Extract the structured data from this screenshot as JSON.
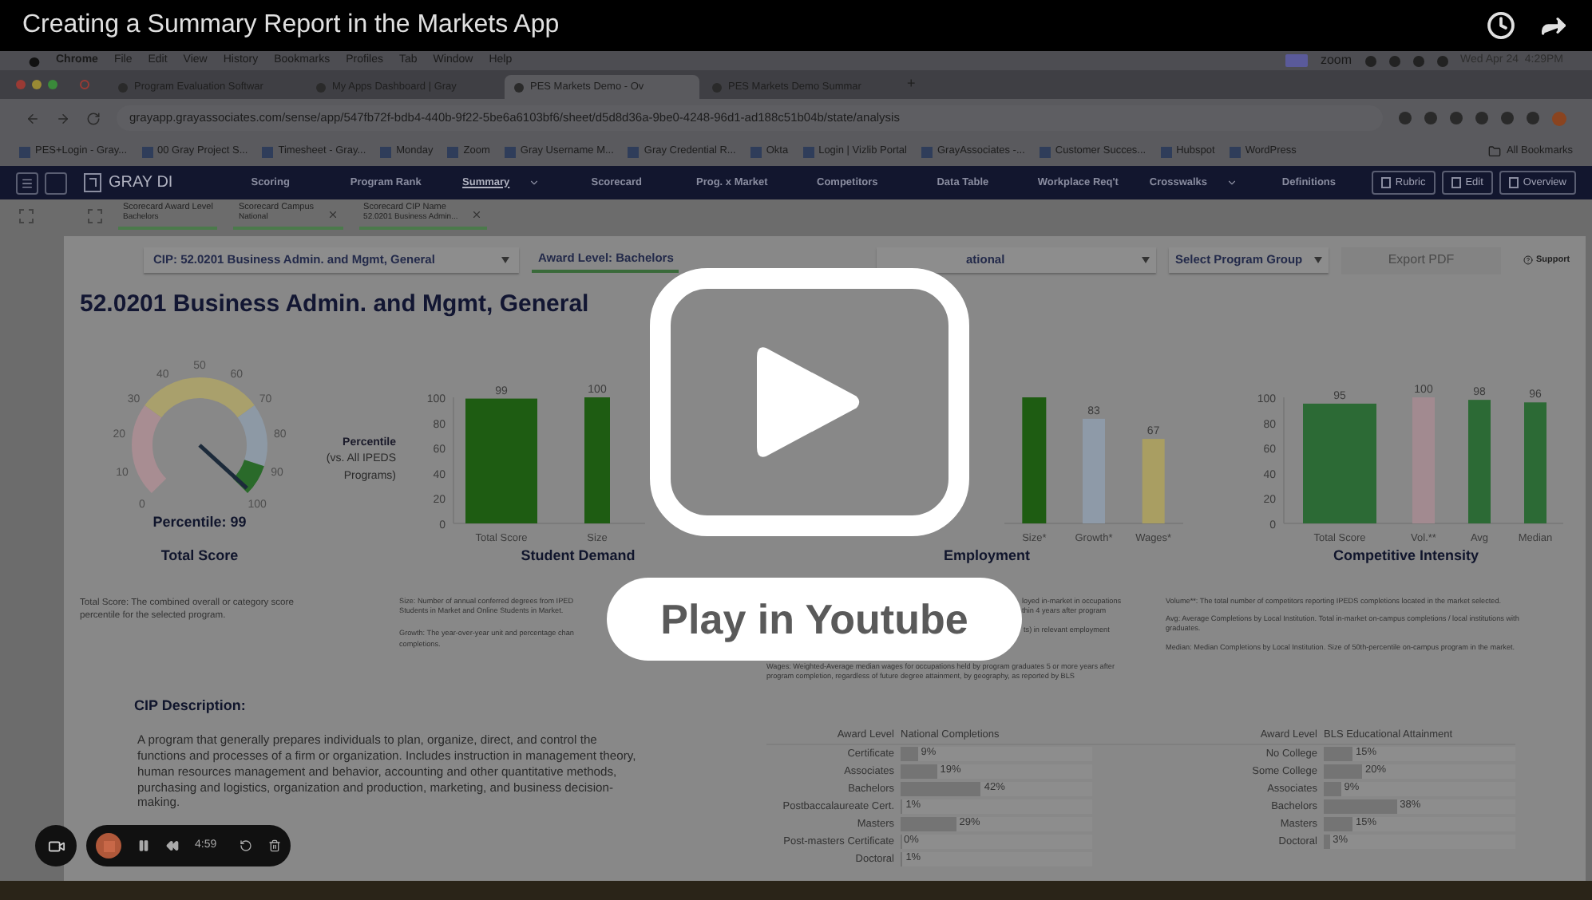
{
  "video": {
    "title": "Creating a Summary Report in the Markets App"
  },
  "mac_menu": {
    "items": [
      "Chrome",
      "File",
      "Edit",
      "View",
      "History",
      "Bookmarks",
      "Profiles",
      "Tab",
      "Window",
      "Help"
    ],
    "status": [
      "zoom",
      "Wed Apr 24  4:29PM"
    ]
  },
  "browser_tabs": [
    {
      "label": "Program Evaluation Softwar",
      "selected": false
    },
    {
      "label": "My Apps Dashboard | Gray",
      "selected": false
    },
    {
      "label": "PES Markets Demo - Ov",
      "selected": true
    },
    {
      "label": "PES Markets Demo Summar",
      "selected": false
    }
  ],
  "new_tab": "+",
  "address": "grayapp.grayassociates.com/sense/app/547fb72f-bdb4-440b-9f22-5be6a6103bf6/sheet/d5d8d36a-9be0-4248-96d1-ad188c51b04b/state/analysis",
  "bookmarks": [
    "PES+Login - Gray...",
    "00 Gray Project S...",
    "Timesheet - Gray...",
    "Monday",
    "Zoom",
    "Gray Username M...",
    "Gray Credential R...",
    "Okta",
    "Login | Vizlib Portal",
    "GrayAssociates -...",
    "Customer Succes...",
    "Hubspot",
    "WordPress"
  ],
  "all_bookmarks": "All Bookmarks",
  "app_nav": {
    "logo": "GRAY DI",
    "items": [
      {
        "label": "Scoring",
        "selected": false,
        "dropdown": false
      },
      {
        "label": "Program Rank",
        "selected": false,
        "dropdown": false
      },
      {
        "label": "Summary",
        "selected": true,
        "dropdown": true
      },
      {
        "label": "Scorecard",
        "selected": false,
        "dropdown": false
      },
      {
        "label": "Prog. x Market",
        "selected": false,
        "dropdown": false
      },
      {
        "label": "Competitors",
        "selected": false,
        "dropdown": false
      },
      {
        "label": "Data Table",
        "selected": false,
        "dropdown": false
      },
      {
        "label": "Workplace Req't",
        "selected": false,
        "dropdown": false
      },
      {
        "label": "Crosswalks",
        "selected": false,
        "dropdown": true
      },
      {
        "label": "Definitions",
        "selected": false,
        "dropdown": false
      }
    ],
    "buttons": [
      "Rubric",
      "Edit",
      "Overview"
    ]
  },
  "selections": [
    {
      "field": "Scorecard Award Level",
      "value": "Bachelors"
    },
    {
      "field": "Scorecard Campus",
      "value": "National"
    },
    {
      "field": "Scorecard CIP Name",
      "value": "52.0201 Business Admin..."
    }
  ],
  "filters": {
    "cip": "CIP: 52.0201 Business Admin. and Mgmt, General",
    "award": "Award Level: Bachelors",
    "campus": "ational",
    "group": "Select Program Group",
    "export": "Export PDF",
    "support": "Support"
  },
  "heading": "52.0201 Business Admin. and Mgmt, General",
  "total_score": {
    "ticks": [
      "0",
      "10",
      "20",
      "30",
      "40",
      "50",
      "60",
      "70",
      "80",
      "90",
      "100"
    ],
    "percentile": "Percentile: 99",
    "title": "Total Score",
    "description": "Total Score: The combined overall or category score percentile for the selected program."
  },
  "student_demand": {
    "axis_label": "Percentile",
    "axis_sublabel": "(vs. All IPEDS Programs)",
    "title": "Student Demand",
    "chart_data": {
      "type": "bar",
      "categories": [
        "Total Score",
        "Size"
      ],
      "values": [
        99,
        100
      ],
      "colors": [
        "#1e5c12",
        "#1e5c12"
      ],
      "ylim": [
        0,
        100
      ],
      "yticks": [
        0,
        20,
        40,
        60,
        80,
        100
      ],
      "value_labels": [
        "99",
        "100"
      ]
    },
    "description": [
      "Size: Number of annual conferred degrees from IPED",
      "Students in Market and Online Students in Market.",
      "Growth: The year-over-year unit and percentage chan",
      "completions."
    ]
  },
  "employment": {
    "title": "Employment",
    "chart_data": {
      "type": "bar",
      "categories": [
        "Size*",
        "Growth*",
        "Wages*"
      ],
      "values": [
        100,
        83,
        67
      ],
      "colors": [
        "#1e5c12",
        "#8e9aa8",
        "#a99e62"
      ],
      "ylim": [
        0,
        100
      ],
      "value_labels": [
        null,
        "83",
        "67"
      ]
    },
    "description": [
      "loyed in-market in occupations",
      "thin 4 years after program",
      "ts) in relevant employment",
      "Wages: Weighted-Average median wages for occupations held by program graduates 5 or more years after program completion, regardless of future degree attainment, by geography, as reported by BLS"
    ]
  },
  "competitive": {
    "title": "Competitive Intensity",
    "chart_data": {
      "type": "bar",
      "categories": [
        "Total Score",
        "Vol.**",
        "Avg",
        "Median"
      ],
      "values": [
        95,
        100,
        98,
        96
      ],
      "colors": [
        "#2c6a35",
        "#a28a90",
        "#2c6a35",
        "#2c6a35"
      ],
      "ylim": [
        0,
        100
      ],
      "yticks": [
        0,
        20,
        40,
        60,
        80,
        100
      ],
      "value_labels": [
        "95",
        "100",
        "98",
        "96"
      ]
    },
    "description": [
      "Volume**: The total number of competitors reporting IPEDS completions located in the market selected.",
      "Avg: Average Completions by Local Institution.  Total in-market on-campus completions / local institutions with graduates.",
      "Median: Median Completions by Local Institution.  Size of 50th-percentile on-campus program in the market."
    ]
  },
  "cip": {
    "heading": "CIP Description:",
    "text": "A program that generally prepares individuals to plan, organize, direct, and control the functions and processes of a firm or organization.  Includes instruction in management theory, human resources management and behavior, accounting and other quantitative methods, purchasing and logistics, organization and production, marketing, and business decision-making."
  },
  "completions_table": {
    "columns": [
      "Award Level",
      "National Completions"
    ],
    "rows": [
      {
        "label": "Certificate",
        "value": "9%",
        "level": 0.09
      },
      {
        "label": "Associates",
        "value": "19%",
        "level": 0.19
      },
      {
        "label": "Bachelors",
        "value": "42%",
        "level": 0.42
      },
      {
        "label": "Postbaccalaureate Cert.",
        "value": "1%",
        "level": 0.01
      },
      {
        "label": "Masters",
        "value": "29%",
        "level": 0.29
      },
      {
        "label": "Post-masters Certificate",
        "value": "0%",
        "level": 0
      },
      {
        "label": "Doctoral",
        "value": "1%",
        "level": 0.01
      }
    ]
  },
  "attainment_table": {
    "columns": [
      "Award Level",
      "BLS Educational Attainment"
    ],
    "rows": [
      {
        "label": "No College",
        "value": "15%",
        "level": 0.15
      },
      {
        "label": "Some College",
        "value": "20%",
        "level": 0.2
      },
      {
        "label": "Associates",
        "value": "9%",
        "level": 0.09
      },
      {
        "label": "Bachelors",
        "value": "38%",
        "level": 0.38
      },
      {
        "label": "Masters",
        "value": "15%",
        "level": 0.15
      },
      {
        "label": "Doctoral",
        "value": "3%",
        "level": 0.03
      }
    ]
  },
  "recorder": {
    "time": "4:59"
  },
  "play_overlay": {
    "label": "Play in Youtube"
  }
}
